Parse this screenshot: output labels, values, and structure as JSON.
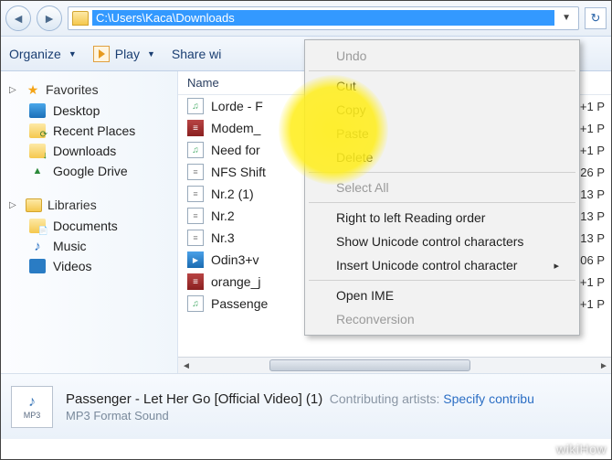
{
  "address_path": "C:\\Users\\Kaca\\Downloads",
  "toolbar": {
    "organize": "Organize",
    "play": "Play",
    "share": "Share wi"
  },
  "sidebar": {
    "favorites": {
      "label": "Favorites",
      "items": [
        "Desktop",
        "Recent Places",
        "Downloads",
        "Google Drive"
      ]
    },
    "libraries": {
      "label": "Libraries",
      "items": [
        "Documents",
        "Music",
        "Videos"
      ]
    }
  },
  "columns": {
    "name": "Name"
  },
  "files": [
    {
      "name": "Lorde - F",
      "type": "music",
      "date": "+1 P"
    },
    {
      "name": "Modem_",
      "type": "rar",
      "date": "+1 P"
    },
    {
      "name": "Need for",
      "type": "music",
      "date": "+1 P"
    },
    {
      "name": "NFS Shift",
      "type": "txt",
      "date": "26 P"
    },
    {
      "name": "Nr.2 (1)",
      "type": "txt",
      "date": "13 P"
    },
    {
      "name": "Nr.2",
      "type": "txt",
      "date": "13 P"
    },
    {
      "name": "Nr.3",
      "type": "txt",
      "date": "13 P"
    },
    {
      "name": "Odin3+v",
      "type": "odin",
      "date": "06 P"
    },
    {
      "name": "orange_j",
      "type": "rar",
      "date": "+1 P"
    },
    {
      "name": "Passenge",
      "type": "music",
      "date": "+1 P"
    }
  ],
  "context_menu": {
    "undo": "Undo",
    "cut": "Cut",
    "copy": "Copy",
    "paste": "Paste",
    "delete": "Delete",
    "select_all": "Select All",
    "rtl": "Right to left Reading order",
    "show_uni": "Show Unicode control characters",
    "insert_uni": "Insert Unicode control character",
    "open_ime": "Open IME",
    "reconversion": "Reconversion"
  },
  "details": {
    "title": "Passenger - Let Her Go [Official Video] (1)",
    "subtitle": "MP3 Format Sound",
    "meta_label": "Contributing artists:",
    "meta_value": "Specify contribu",
    "icon_label": "MP3"
  },
  "watermark": "wikiHow"
}
